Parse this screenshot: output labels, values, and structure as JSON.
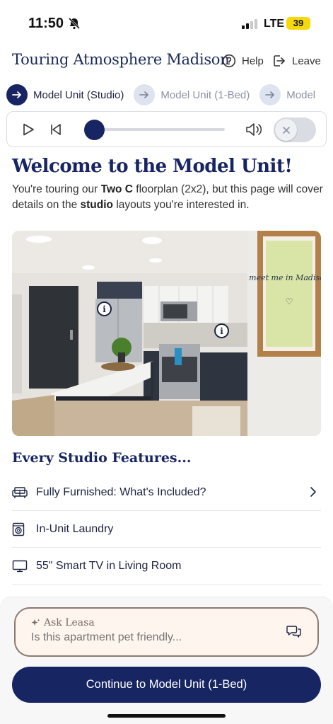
{
  "status_bar": {
    "time": "11:50",
    "network": "LTE",
    "battery": "39"
  },
  "header": {
    "title": "Touring Atmosphere Madison",
    "help_label": "Help",
    "leave_label": "Leave"
  },
  "steps": [
    {
      "label": "Model Unit (Studio)",
      "active": true
    },
    {
      "label": "Model Unit (1-Bed)",
      "active": false
    },
    {
      "label": "Model",
      "active": false
    }
  ],
  "audio_player": {
    "progress": 0.0,
    "caption_toggle": "off"
  },
  "welcome": {
    "title": "Welcome to the Model Unit!",
    "text_1": "You're touring our ",
    "text_bold_1": "Two C",
    "text_2": " floorplan (2x2), but this page will cover details on the ",
    "text_bold_2": "studio",
    "text_3": " layouts you're interested in."
  },
  "photo": {
    "sign_text": "meet me in Madison"
  },
  "features": {
    "title": "Every Studio Features...",
    "items": [
      {
        "label": "Fully Furnished: What's Included?",
        "icon": "sofa-icon",
        "has_chevron": true
      },
      {
        "label": "In-Unit Laundry",
        "icon": "washer-icon",
        "has_chevron": false
      },
      {
        "label": "55\" Smart TV in Living Room",
        "icon": "tv-icon",
        "has_chevron": false
      }
    ]
  },
  "ask": {
    "label": "Ask Leasa",
    "placeholder": "Is this apartment pet friendly..."
  },
  "continue_button": {
    "label": "Continue to Model Unit (1-Bed)"
  }
}
